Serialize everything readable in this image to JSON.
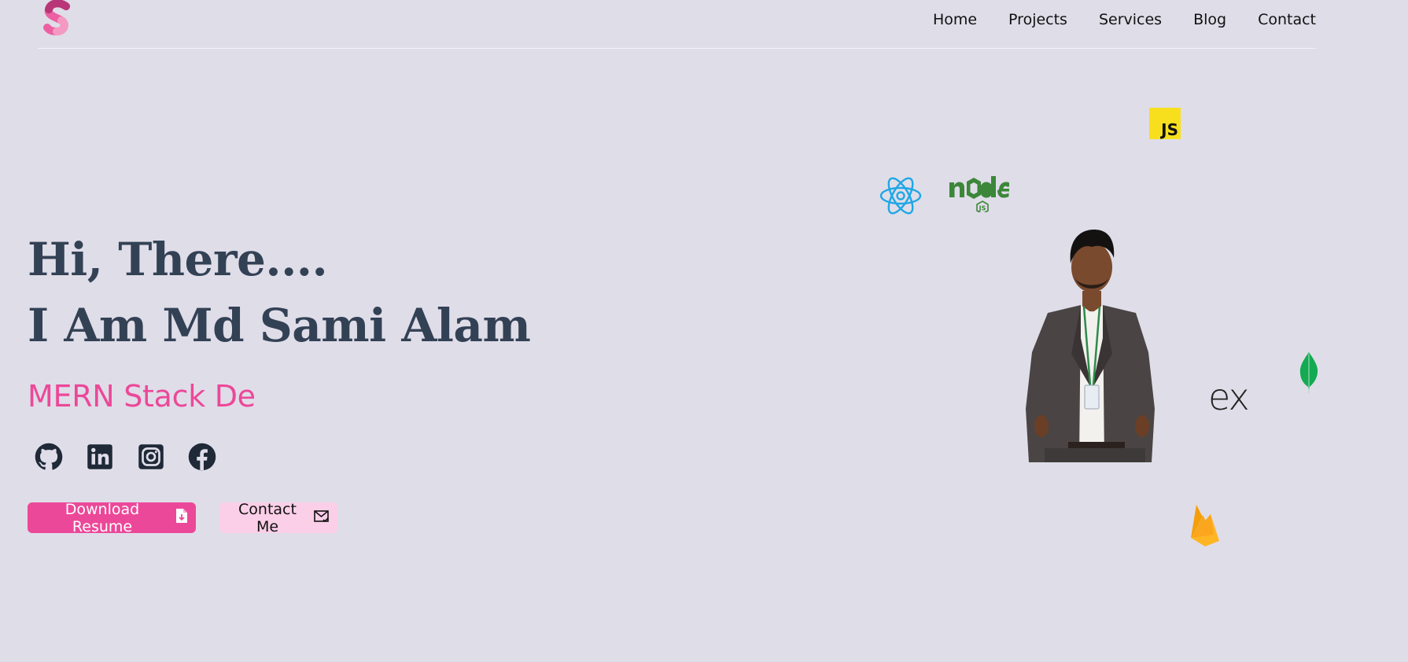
{
  "nav": {
    "logo_icon": "s-logo-icon",
    "links": [
      "Home",
      "Projects",
      "Services",
      "Blog",
      "Contact"
    ]
  },
  "hero": {
    "greeting": "Hi, There....",
    "name_line": "I Am Md Sami Alam",
    "role_text": "MERN Stack De",
    "buttons": {
      "download": "Download Resume",
      "contact": "Contact Me"
    }
  },
  "socials": [
    "github-icon",
    "linkedin-icon",
    "instagram-icon",
    "facebook-icon"
  ],
  "tech_icons": {
    "js_label": "JS",
    "express_label": "ex",
    "icons": [
      "javascript-icon",
      "react-icon",
      "nodejs-icon",
      "mongodb-icon",
      "express-icon",
      "firebase-icon"
    ]
  },
  "colors": {
    "background": "#dfdde8",
    "accent": "#ec4899",
    "heading": "#334155",
    "secondary_button": "#fbcfe8",
    "js_yellow": "#f7df1e",
    "react_blue": "#1ea7e6",
    "node_green": "#3c873a",
    "mongo_green": "#13aa52",
    "firebase_orange": "#f59e0b"
  }
}
